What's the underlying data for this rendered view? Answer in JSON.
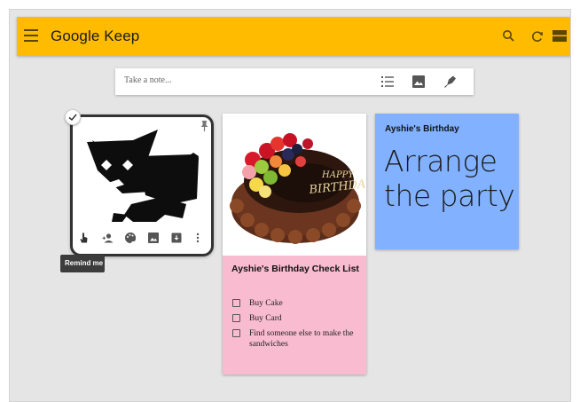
{
  "app": {
    "title": "Google Keep",
    "accent_color": "#ffbb00"
  },
  "toolbar": {
    "icons": [
      "menu-icon",
      "search-icon",
      "refresh-icon",
      "list-view-icon"
    ]
  },
  "take_note": {
    "placeholder": "Take a note...",
    "icons": [
      "checklist-icon",
      "image-icon",
      "pen-icon"
    ]
  },
  "notes": [
    {
      "type": "image",
      "color": "#ffffff",
      "selected": true,
      "image": "dog-icon",
      "toolbar_icons": [
        "remind-me-icon",
        "collaborator-icon",
        "palette-icon",
        "image-icon",
        "archive-icon",
        "more-icon"
      ],
      "tooltip": "Remind me"
    },
    {
      "type": "checklist",
      "color": "#f8bbd0",
      "image": "birthday-cake",
      "cake_text": "HAPPY BIRTHDAY",
      "title": "Ayshie's Birthday Check List",
      "items": [
        {
          "text": "Buy Cake",
          "checked": false
        },
        {
          "text": "Buy Card",
          "checked": false
        },
        {
          "text": "Find someone else to make the sandwiches",
          "checked": false
        }
      ]
    },
    {
      "type": "text",
      "color": "#82b1ff",
      "title": "Ayshie's Birthday",
      "body": "Arrange the party"
    }
  ]
}
